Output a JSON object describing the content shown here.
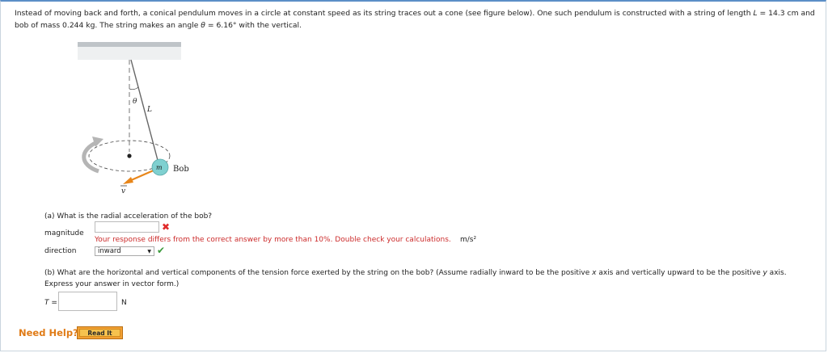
{
  "intro": {
    "part1": "Instead of moving back and forth, a conical pendulum moves in a circle at constant speed as its string traces out a cone (see figure below). One such pendulum is constructed with a string of length ",
    "L_symbol": "L",
    "part2": " = 14.3 cm and bob of mass 0.244 kg. The string makes an angle ",
    "theta_symbol": "θ",
    "part3": " = 6.16° with the vertical."
  },
  "figure": {
    "theta_label": "θ",
    "L_label": "L",
    "m_label": "m",
    "bob_label": "Bob",
    "v_label": "v"
  },
  "part_a": {
    "question": "(a) What is the radial acceleration of the bob?",
    "magnitude_label": "magnitude",
    "magnitude_value": "",
    "error_message": "Your response differs from the correct answer by more than 10%. Double check your calculations.",
    "unit": "m/s²",
    "direction_label": "direction",
    "direction_value": "inward"
  },
  "part_b": {
    "question_line1_a": "(b) What are the horizontal and vertical components of the tension force exerted by the string on the bob? (Assume radially inward to be the positive ",
    "x_symbol": "x",
    "question_line1_b": " axis and vertically upward to be the positive ",
    "y_symbol": "y",
    "question_line1_c": " axis.",
    "question_line2": "Express your answer in vector form.)",
    "T_label": "T =",
    "T_value": "",
    "unit": "N"
  },
  "help": {
    "need_help": "Need Help?",
    "read_it": "Read It"
  },
  "colors": {
    "error": "#cc2b2b",
    "need_help": "#e07b16",
    "bob": "#7fd0d0",
    "velocity_arrow": "#e8861a"
  }
}
